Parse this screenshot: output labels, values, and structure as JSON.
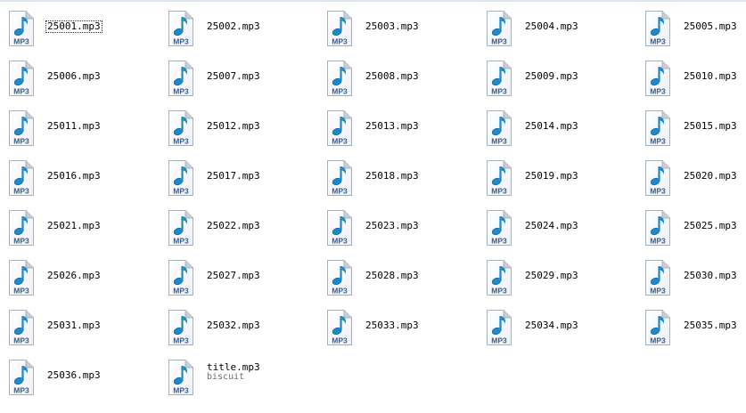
{
  "file_view": {
    "icon": "mp3-audio-file-icon",
    "icon_text": "MP3",
    "selected_index": 0,
    "files": [
      {
        "name": "25001.mp3"
      },
      {
        "name": "25002.mp3"
      },
      {
        "name": "25003.mp3"
      },
      {
        "name": "25004.mp3"
      },
      {
        "name": "25005.mp3"
      },
      {
        "name": "25006.mp3"
      },
      {
        "name": "25007.mp3"
      },
      {
        "name": "25008.mp3"
      },
      {
        "name": "25009.mp3"
      },
      {
        "name": "25010.mp3"
      },
      {
        "name": "25011.mp3"
      },
      {
        "name": "25012.mp3"
      },
      {
        "name": "25013.mp3"
      },
      {
        "name": "25014.mp3"
      },
      {
        "name": "25015.mp3"
      },
      {
        "name": "25016.mp3"
      },
      {
        "name": "25017.mp3"
      },
      {
        "name": "25018.mp3"
      },
      {
        "name": "25019.mp3"
      },
      {
        "name": "25020.mp3"
      },
      {
        "name": "25021.mp3"
      },
      {
        "name": "25022.mp3"
      },
      {
        "name": "25023.mp3"
      },
      {
        "name": "25024.mp3"
      },
      {
        "name": "25025.mp3"
      },
      {
        "name": "25026.mp3"
      },
      {
        "name": "25027.mp3"
      },
      {
        "name": "25028.mp3"
      },
      {
        "name": "25029.mp3"
      },
      {
        "name": "25030.mp3"
      },
      {
        "name": "25031.mp3"
      },
      {
        "name": "25032.mp3"
      },
      {
        "name": "25033.mp3"
      },
      {
        "name": "25034.mp3"
      },
      {
        "name": "25035.mp3"
      },
      {
        "name": "25036.mp3"
      },
      {
        "name": "title.mp3",
        "subtitle": "biscuit"
      }
    ]
  },
  "colors": {
    "note": "#1e88c8",
    "note_dark": "#0d5f9a",
    "icon_label": "#3a5b86",
    "page_fold": "#c9ced6"
  }
}
